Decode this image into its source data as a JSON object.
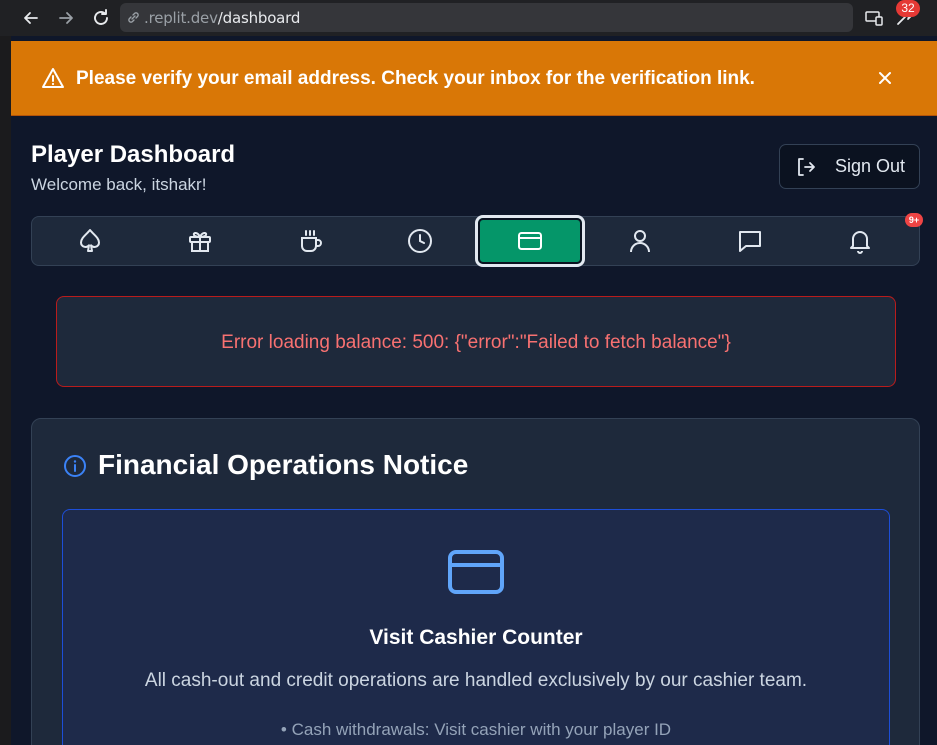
{
  "browser": {
    "url_prefix": ".replit.dev",
    "url_path": "/dashboard",
    "extension_badge": "32"
  },
  "banner": {
    "message": "Please verify your email address. Check your inbox for the verification link.",
    "icon": "warning-triangle-icon",
    "color": "#d97706"
  },
  "header": {
    "title": "Player Dashboard",
    "welcome": "Welcome back, itshakr!",
    "sign_out_label": "Sign Out"
  },
  "tabs": [
    {
      "icon": "spade-icon",
      "active": false
    },
    {
      "icon": "gift-icon",
      "active": false
    },
    {
      "icon": "coffee-icon",
      "active": false
    },
    {
      "icon": "clock-icon",
      "active": false
    },
    {
      "icon": "credit-card-icon",
      "active": true
    },
    {
      "icon": "user-icon",
      "active": false
    },
    {
      "icon": "message-icon",
      "active": false
    },
    {
      "icon": "bell-icon",
      "active": false,
      "badge": "9+"
    }
  ],
  "error": {
    "message": "Error loading balance: 500: {\"error\":\"Failed to fetch balance\"}",
    "color": "#f87171"
  },
  "notice": {
    "title": "Financial Operations Notice",
    "card_title": "Visit Cashier Counter",
    "description": "All cash-out and credit operations are handled exclusively by our cashier team.",
    "bullet": "• Cash withdrawals: Visit cashier with your player ID"
  },
  "colors": {
    "accent": "#059669",
    "background": "#0f172a",
    "card_icon": "#60a5fa"
  }
}
